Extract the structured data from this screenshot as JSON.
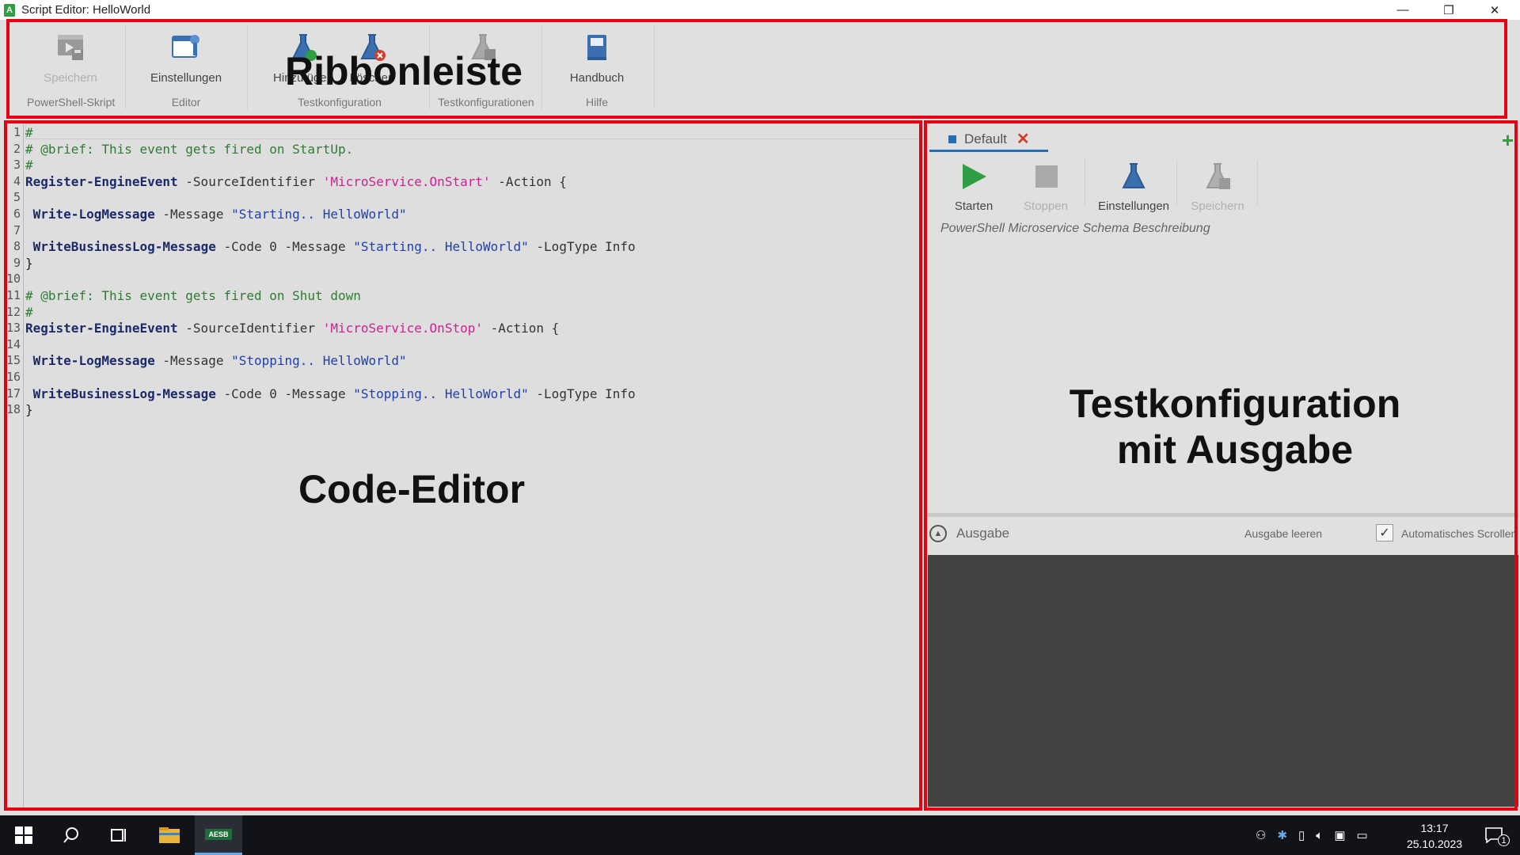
{
  "window": {
    "title": "Script Editor: HelloWorld",
    "app_icon_letter": "A",
    "controls": {
      "minimize": "—",
      "restore": "❐",
      "close": "✕"
    }
  },
  "ribbon": {
    "groups": [
      {
        "label": "PowerShell-Skript",
        "buttons": [
          {
            "label": "Speichern",
            "icon": "save-script-icon",
            "disabled": true
          }
        ]
      },
      {
        "label": "Editor",
        "buttons": [
          {
            "label": "Einstellungen",
            "icon": "editor-settings-icon",
            "disabled": false
          }
        ]
      },
      {
        "label": "Testkonfiguration",
        "buttons": [
          {
            "label": "Hinzufügen",
            "icon": "flask-add-icon",
            "disabled": false
          },
          {
            "label": "Löschen",
            "icon": "flask-delete-icon",
            "disabled": false
          }
        ]
      },
      {
        "label": "Testkonfigurationen",
        "buttons": [
          {
            "label": "",
            "icon": "flask-save-icon",
            "disabled": true
          }
        ]
      },
      {
        "label": "Hilfe",
        "buttons": [
          {
            "label": "Handbuch",
            "icon": "book-icon",
            "disabled": false
          }
        ]
      }
    ]
  },
  "overlays": {
    "ribbon": "Ribbonleiste",
    "editor": "Code-Editor",
    "test_line1": "Testkonfiguration",
    "test_line2": "mit Ausgabe",
    "frame_color": "#e60012"
  },
  "editor": {
    "lines": [
      {
        "n": "1",
        "tokens": [
          {
            "t": "#",
            "c": "comment"
          }
        ]
      },
      {
        "n": "2",
        "tokens": [
          {
            "t": "# @brief: This event gets fired on StartUp.",
            "c": "comment"
          }
        ]
      },
      {
        "n": "3",
        "tokens": [
          {
            "t": "#",
            "c": "comment"
          }
        ]
      },
      {
        "n": "4",
        "tokens": [
          {
            "t": "Register-EngineEvent",
            "c": "kw"
          },
          {
            "t": " -SourceIdentifier ",
            "c": "param"
          },
          {
            "t": "'MicroService.OnStart'",
            "c": "str1"
          },
          {
            "t": " -Action {",
            "c": "param"
          }
        ]
      },
      {
        "n": "5",
        "tokens": []
      },
      {
        "n": "6",
        "tokens": [
          {
            "t": " ",
            "c": "plain"
          },
          {
            "t": "Write-LogMessage",
            "c": "kw"
          },
          {
            "t": " -Message ",
            "c": "param"
          },
          {
            "t": "\"Starting.. HelloWorld\"",
            "c": "str2"
          }
        ]
      },
      {
        "n": "7",
        "tokens": []
      },
      {
        "n": "8",
        "tokens": [
          {
            "t": " ",
            "c": "plain"
          },
          {
            "t": "WriteBusinessLog-Message",
            "c": "kw"
          },
          {
            "t": " -Code 0 -Message ",
            "c": "param"
          },
          {
            "t": "\"Starting.. HelloWorld\"",
            "c": "str2"
          },
          {
            "t": " -LogType Info",
            "c": "param"
          }
        ]
      },
      {
        "n": "9",
        "tokens": [
          {
            "t": "}",
            "c": "plain"
          }
        ]
      },
      {
        "n": "10",
        "tokens": []
      },
      {
        "n": "11",
        "tokens": [
          {
            "t": "# @brief: This event gets fired on Shut down",
            "c": "comment"
          }
        ]
      },
      {
        "n": "12",
        "tokens": [
          {
            "t": "#",
            "c": "comment"
          }
        ]
      },
      {
        "n": "13",
        "tokens": [
          {
            "t": "Register-EngineEvent",
            "c": "kw"
          },
          {
            "t": " -SourceIdentifier ",
            "c": "param"
          },
          {
            "t": "'MicroService.OnStop'",
            "c": "str1"
          },
          {
            "t": " -Action {",
            "c": "param"
          }
        ]
      },
      {
        "n": "14",
        "tokens": []
      },
      {
        "n": "15",
        "tokens": [
          {
            "t": " ",
            "c": "plain"
          },
          {
            "t": "Write-LogMessage",
            "c": "kw"
          },
          {
            "t": " -Message ",
            "c": "param"
          },
          {
            "t": "\"Stopping.. HelloWorld\"",
            "c": "str2"
          }
        ]
      },
      {
        "n": "16",
        "tokens": []
      },
      {
        "n": "17",
        "tokens": [
          {
            "t": " ",
            "c": "plain"
          },
          {
            "t": "WriteBusinessLog-Message",
            "c": "kw"
          },
          {
            "t": " -Code 0 -Message ",
            "c": "param"
          },
          {
            "t": "\"Stopping.. HelloWorld\"",
            "c": "str2"
          },
          {
            "t": " -LogType Info",
            "c": "param"
          }
        ]
      },
      {
        "n": "18",
        "tokens": [
          {
            "t": "}",
            "c": "plain"
          }
        ]
      }
    ]
  },
  "test_panel": {
    "tab_label": "Default",
    "add_label": "+",
    "toolbar": {
      "start": {
        "label": "Starten",
        "icon": "play-icon",
        "disabled": false
      },
      "stop": {
        "label": "Stoppen",
        "icon": "stop-icon",
        "disabled": true
      },
      "settings": {
        "label": "Einstellungen",
        "icon": "flask-settings-icon",
        "disabled": false
      },
      "save": {
        "label": "Speichern",
        "icon": "flask-save-icon",
        "disabled": true
      }
    },
    "schema_description": "PowerShell Microservice Schema Beschreibung",
    "output": {
      "title": "Ausgabe",
      "clear_label": "Ausgabe leeren",
      "autoscroll_label": "Automatisches Scrollen",
      "autoscroll_checked": true
    }
  },
  "taskbar": {
    "active_app_label": "AESB",
    "time": "13:17",
    "date": "25.10.2023",
    "notification_count": "1"
  }
}
